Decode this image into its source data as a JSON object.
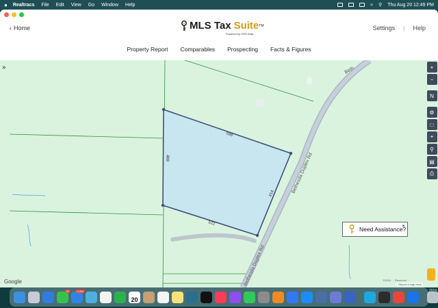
{
  "menubar": {
    "app_name": "Realtracs",
    "items": [
      "File",
      "Edit",
      "View",
      "Go",
      "Window",
      "Help"
    ],
    "datetime": "Thu Aug 20  12:49 PM"
  },
  "header": {
    "back_label": "Home",
    "logo_part1": "MLS Tax",
    "logo_part2": "Suite",
    "logo_tm": "TM",
    "powered_by": "Powered by CRS Data",
    "settings_label": "Settings",
    "separator": "|",
    "help_label": "Help"
  },
  "nav": {
    "items": [
      "Property Report",
      "Comparables",
      "Prospecting",
      "Facts & Figures"
    ]
  },
  "map": {
    "collapse_glyph": "»",
    "parcel_dims": [
      "598",
      "414",
      "522",
      "469"
    ],
    "road_name_1": "Bethesda Duplex Rd",
    "road_name_2": "Bethesda Duplex Rd",
    "road_name_top": "Beth",
    "google_label": "Google",
    "copyright": "©2024 ... Reserved",
    "report_error": "Report a map error",
    "keyboard_label": "Keyboard",
    "tools": [
      "+",
      "−",
      "N",
      "gear",
      "square",
      "target",
      "search",
      "layers",
      "print"
    ]
  },
  "assist": {
    "label": "Need Assistance?",
    "close": "✕"
  },
  "dock": {
    "calendar_day": "20",
    "mail_badge": "9,865",
    "messages_badge": "53",
    "year_fragment": "2024"
  },
  "colors": {
    "map_bg": "#daf3df",
    "parcel_fill": "#c8e6ef",
    "parcel_stroke": "#3f4f78",
    "road": "#a9b7c4",
    "brand_gold": "#d99a1b"
  }
}
